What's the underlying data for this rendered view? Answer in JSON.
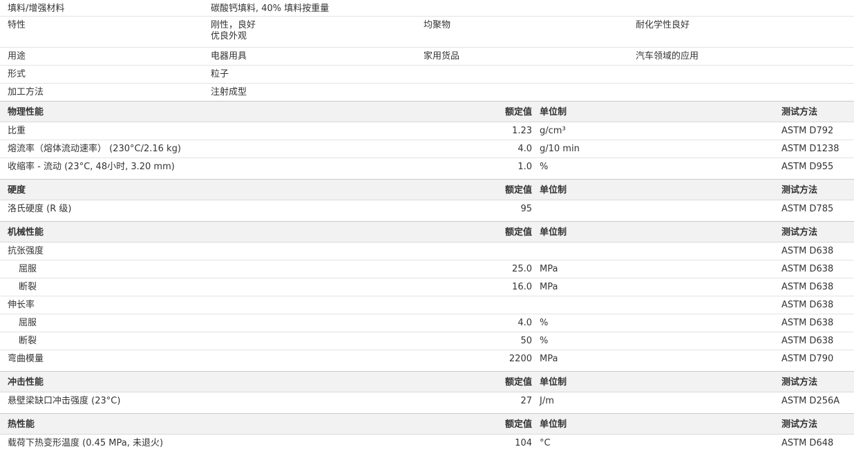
{
  "info": {
    "filler": {
      "label": "填料/增强材料",
      "values": [
        "碳酸钙填料, 40% 填料按重量"
      ]
    },
    "features": {
      "label": "特性",
      "col1": [
        "刚性，良好",
        "优良外观"
      ],
      "col2": "均聚物",
      "col3": "耐化学性良好"
    },
    "uses": {
      "label": "用途",
      "col1": "电器用具",
      "col2": "家用货品",
      "col3": "汽车领域的应用"
    },
    "form": {
      "label": "形式",
      "col1": "粒子"
    },
    "processing": {
      "label": "加工方法",
      "col1": "注射成型"
    }
  },
  "headers": {
    "value": "额定值",
    "unit": "单位制",
    "method": "测试方法"
  },
  "sections": [
    {
      "title": "物理性能",
      "rows": [
        {
          "name": "比重",
          "value": "1.23",
          "unit": "g/cm³",
          "method": "ASTM D792",
          "sub": false
        },
        {
          "name": "熔流率（熔体流动速率） (230°C/2.16 kg)",
          "value": "4.0",
          "unit": "g/10 min",
          "method": "ASTM D1238",
          "sub": false
        },
        {
          "name": "收缩率 - 流动 (23°C, 48小时, 3.20 mm)",
          "value": "1.0",
          "unit": "%",
          "method": "ASTM D955",
          "sub": false
        }
      ]
    },
    {
      "title": "硬度",
      "rows": [
        {
          "name": "洛氏硬度 (R 级)",
          "value": "95",
          "unit": "",
          "method": "ASTM D785",
          "sub": false
        }
      ]
    },
    {
      "title": "机械性能",
      "rows": [
        {
          "name": "抗张强度",
          "value": "",
          "unit": "",
          "method": "ASTM D638",
          "sub": false
        },
        {
          "name": "屈服",
          "value": "25.0",
          "unit": "MPa",
          "method": "ASTM D638",
          "sub": true
        },
        {
          "name": "断裂",
          "value": "16.0",
          "unit": "MPa",
          "method": "ASTM D638",
          "sub": true
        },
        {
          "name": "伸长率",
          "value": "",
          "unit": "",
          "method": "ASTM D638",
          "sub": false
        },
        {
          "name": "屈服",
          "value": "4.0",
          "unit": "%",
          "method": "ASTM D638",
          "sub": true
        },
        {
          "name": "断裂",
          "value": "50",
          "unit": "%",
          "method": "ASTM D638",
          "sub": true
        },
        {
          "name": "弯曲模量",
          "value": "2200",
          "unit": "MPa",
          "method": "ASTM D790",
          "sub": false
        }
      ]
    },
    {
      "title": "冲击性能",
      "rows": [
        {
          "name": "悬壁梁缺口冲击强度 (23°C)",
          "value": "27",
          "unit": "J/m",
          "method": "ASTM D256A",
          "sub": false
        }
      ]
    },
    {
      "title": "热性能",
      "rows": [
        {
          "name": "载荷下热变形温度 (0.45 MPa, 未退火)",
          "value": "104",
          "unit": "°C",
          "method": "ASTM D648",
          "sub": false
        }
      ]
    }
  ]
}
